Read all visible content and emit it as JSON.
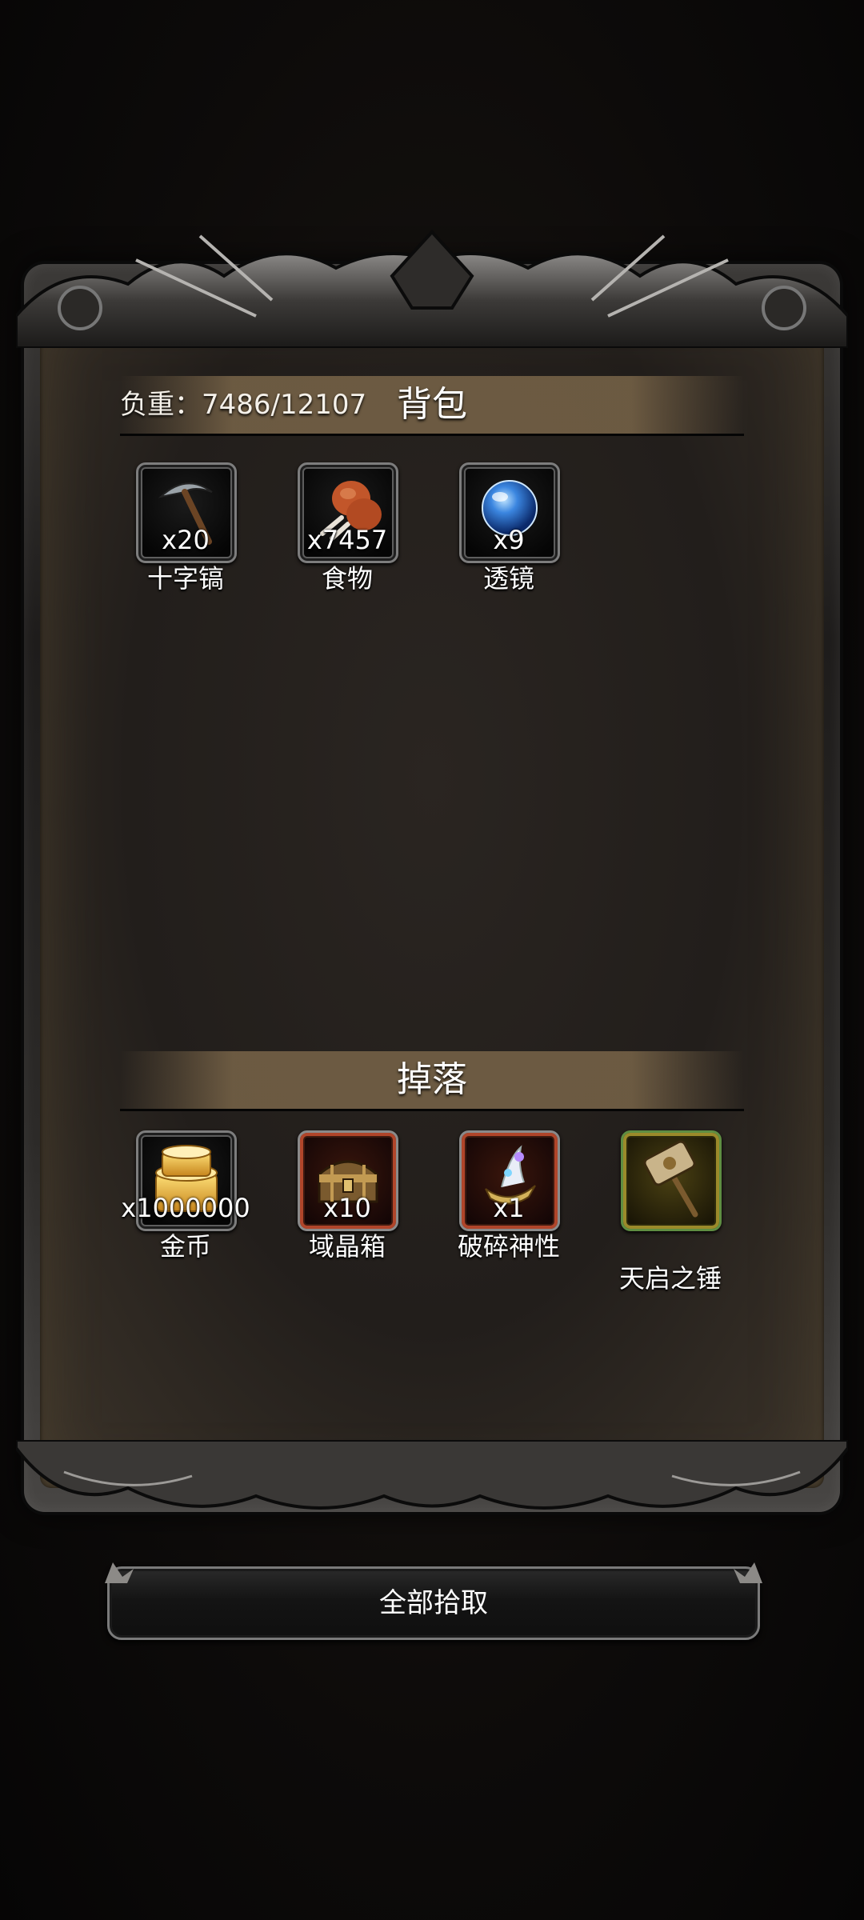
{
  "backpack": {
    "title": "背包",
    "weight_label": "负重：7486/12107",
    "items": [
      {
        "name": "十字镐",
        "count": "x20",
        "icon": "pickaxe-icon"
      },
      {
        "name": "食物",
        "count": "x7457",
        "icon": "meat-icon"
      },
      {
        "name": "透镜",
        "count": "x9",
        "icon": "lens-orb-icon"
      }
    ]
  },
  "drops": {
    "title": "掉落",
    "items": [
      {
        "name": "金币",
        "count": "x1000000",
        "icon": "gold-coins-icon",
        "rarity": "normal"
      },
      {
        "name": "域晶箱",
        "count": "x10",
        "icon": "treasure-chest-icon",
        "rarity": "orange"
      },
      {
        "name": "破碎神性",
        "count": "x1",
        "icon": "lamp-icon",
        "rarity": "orange"
      },
      {
        "name": "天启之锤",
        "count": "",
        "icon": "hammer-icon",
        "rarity": "gold"
      }
    ]
  },
  "actions": {
    "pickup_all": "全部拾取"
  },
  "colors": {
    "panel": "#221e1b",
    "header_band": "#786448",
    "orange_rarity": "#b0452a",
    "gold_rarity": "#9b8a2a"
  }
}
